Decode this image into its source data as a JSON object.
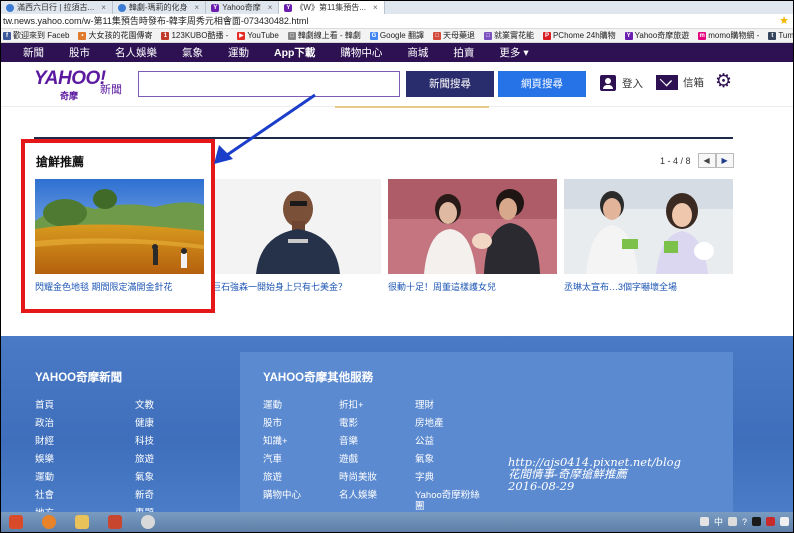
{
  "browser": {
    "tabs": [
      {
        "label": "滿西六日行 | 拉須古...",
        "icon": "g",
        "active": false
      },
      {
        "label": "韓劇-瑪莉的化身",
        "icon": "g",
        "active": false
      },
      {
        "label": "Yahoo奇摩",
        "icon": "y",
        "active": false
      },
      {
        "label": "《W》第11集預告...",
        "icon": "y",
        "active": true
      }
    ],
    "url": "tw.news.yahoo.com/w-第11集預告時發布-韓李周秀元相會面-073430482.html",
    "bookmarks": [
      {
        "label": "歡迎來到 Faceb",
        "color": "#3b5998",
        "glyph": "f"
      },
      {
        "label": "大女孩的花園傳寄",
        "color": "#e07a2c",
        "glyph": "•"
      },
      {
        "label": "123KUBO酷播 -",
        "color": "#c0392b",
        "glyph": "1"
      },
      {
        "label": "YouTube",
        "color": "#e52d27",
        "glyph": "▶"
      },
      {
        "label": "韓劇線上看 - 韓劇",
        "color": "#888888",
        "glyph": "□"
      },
      {
        "label": "Google 翻譯",
        "color": "#4285f4",
        "glyph": "G"
      },
      {
        "label": "天母藥退",
        "color": "#d24a3c",
        "glyph": "□"
      },
      {
        "label": "就業實花能",
        "color": "#7a4fbf",
        "glyph": "□"
      },
      {
        "label": "PChome 24h購物",
        "color": "#d81e23",
        "glyph": "P"
      },
      {
        "label": "Yahoo奇摩旅遊",
        "color": "#6a1fb0",
        "glyph": "Y"
      },
      {
        "label": "momo購物網 -",
        "color": "#e4007f",
        "glyph": "m"
      },
      {
        "label": "Tumblr",
        "color": "#35465c",
        "glyph": "t"
      }
    ]
  },
  "yahoo": {
    "nav": [
      "新聞",
      "股市",
      "名人娛樂",
      "氣象",
      "運動",
      "App下載",
      "購物中心",
      "商城",
      "拍賣",
      "更多 ▾"
    ],
    "logo_main": "YAHOO!",
    "logo_sub": "奇摩",
    "logo_section": "新聞",
    "search_placeholder": "",
    "btn_news": "新聞搜尋",
    "btn_web": "網頁搜尋",
    "login": "登入",
    "mail": "信箱"
  },
  "section": {
    "title": "搶鮮推薦",
    "pager": "1 - 4 / 8",
    "prev": "◀",
    "next": "▶",
    "cards": [
      {
        "caption": "閃耀金色地毯 期間限定滿開金針花"
      },
      {
        "caption": "巨石強森一開始身上只有七美金？"
      },
      {
        "caption": "很動十足！周董這樣護女兒"
      },
      {
        "caption": "丞琳太宣布…3個字嚇壞全場"
      }
    ]
  },
  "footer": {
    "news_title": "YAHOO奇摩新聞",
    "news_col1": [
      "首頁",
      "政治",
      "財經",
      "娛樂",
      "運動",
      "社會",
      "地方"
    ],
    "news_col2": [
      "文教",
      "健康",
      "科技",
      "旅遊",
      "氣象",
      "新奇",
      "專題"
    ],
    "other_title": "YAHOO奇摩其他服務",
    "other_col1": [
      "運動",
      "股市",
      "知識+",
      "汽車",
      "旅遊",
      "購物中心"
    ],
    "other_col2": [
      "折扣+",
      "電影",
      "音樂",
      "遊戲",
      "時尚美妝",
      "名人娛樂"
    ],
    "other_col3": [
      "理財",
      "房地產",
      "公益",
      "氣象",
      "字典",
      "Yahoo奇摩粉絲",
      "團"
    ],
    "watermark_1": "http://ajs0414.pixnet.net/blog",
    "watermark_2": "花間情事-奇摩搶鮮推薦",
    "watermark_3": "2016-08-29"
  },
  "taskbar": {
    "clock": "中",
    "tray_mark": "?"
  },
  "colors": {
    "nav_bg": "#2d1152",
    "search_news_btn": "#2a2d6d",
    "search_web_btn": "#2673e8",
    "highlight": "#e41818",
    "arrow": "#1a3ec9",
    "footer_bg": "#4a7ac4"
  }
}
